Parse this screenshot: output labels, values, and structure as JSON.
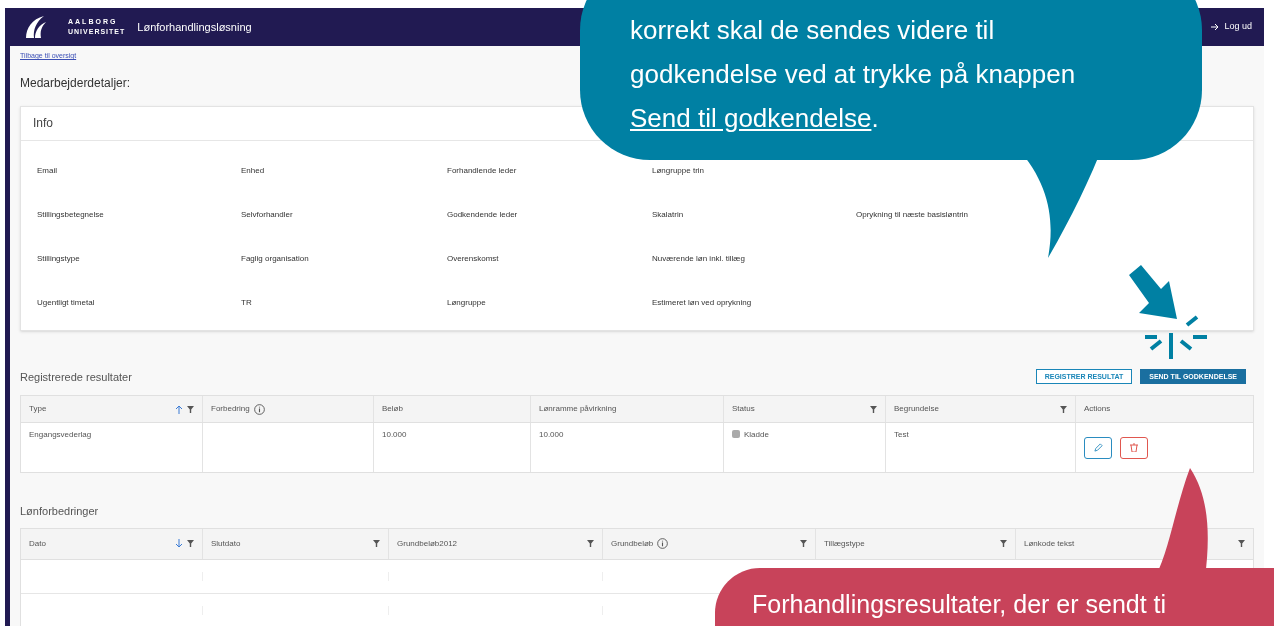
{
  "header": {
    "logo_line1": "AALBORG",
    "logo_line2": "UNIVERSITET",
    "app_title": "Lønforhandlingsløsning",
    "logout": "Log ud"
  },
  "back_link": "Tilbage til oversigt",
  "page_title": "Medarbejderdetaljer:",
  "info": {
    "title": "Info",
    "rows": [
      [
        "Email",
        "Enhed",
        "Forhandlende leder",
        "Løngruppe trin",
        null
      ],
      [
        "Stillingsbetegnelse",
        "Selvforhandler",
        "Godkendende leder",
        "Skalatrin",
        "Oprykning til næste basisløntrin"
      ],
      [
        "Stillingstype",
        "Faglig organisation",
        "Overenskomst",
        "Nuværende løn inkl. tillæg",
        null
      ],
      [
        "Ugentligt timetal",
        "TR",
        "Løngruppe",
        "Estimeret løn ved oprykning",
        null
      ]
    ]
  },
  "results": {
    "title": "Registrerede resultater",
    "buttons": [
      {
        "label": "REGISTRER RESULTAT",
        "kind": "outline"
      },
      {
        "label": "SEND TIL GODKENDELSE",
        "kind": "primary"
      }
    ],
    "columns": [
      {
        "label": "Type",
        "sorted": true,
        "descending": false,
        "filter": true,
        "info": false
      },
      {
        "label": "Forbedring",
        "sorted": false,
        "filter": false,
        "info": true
      },
      {
        "label": "Beløb",
        "sorted": false,
        "filter": false,
        "info": false
      },
      {
        "label": "Lønramme påvirkning",
        "sorted": false,
        "filter": false,
        "info": false
      },
      {
        "label": "Status",
        "sorted": false,
        "filter": true,
        "info": false
      },
      {
        "label": "Begrundelse",
        "sorted": false,
        "filter": true,
        "info": false
      },
      {
        "label": "Actions",
        "sorted": false,
        "filter": false,
        "info": false
      }
    ],
    "rows": [
      {
        "type": "Engangsvederlag",
        "forbedring": "",
        "belob": "10.000",
        "lonramme": "10.000",
        "status": "Kladde",
        "begrundelse": "Test"
      }
    ]
  },
  "improvements": {
    "title": "Lønforbedringer",
    "columns": [
      {
        "label": "Dato",
        "sorted": true,
        "descending": true,
        "filter": true,
        "info": false
      },
      {
        "label": "Slutdato",
        "sorted": false,
        "filter": true,
        "info": false
      },
      {
        "label": "Grundbeløb2012",
        "sorted": false,
        "filter": true,
        "info": false
      },
      {
        "label": "Grundbeløb",
        "sorted": false,
        "filter": true,
        "info": true
      },
      {
        "label": "Tillægstype",
        "sorted": false,
        "filter": true,
        "info": false
      },
      {
        "label": "Lønkode tekst",
        "sorted": false,
        "filter": true,
        "info": false
      }
    ]
  },
  "callout_top": {
    "lines": [
      "korrekt skal de sendes videre til",
      "godkendelse ved at trykke på knappen"
    ],
    "link": "Send til godkendelse",
    "after": "."
  },
  "callout_bottom": {
    "text": "Forhandlingsresultater, der er sendt ti"
  }
}
